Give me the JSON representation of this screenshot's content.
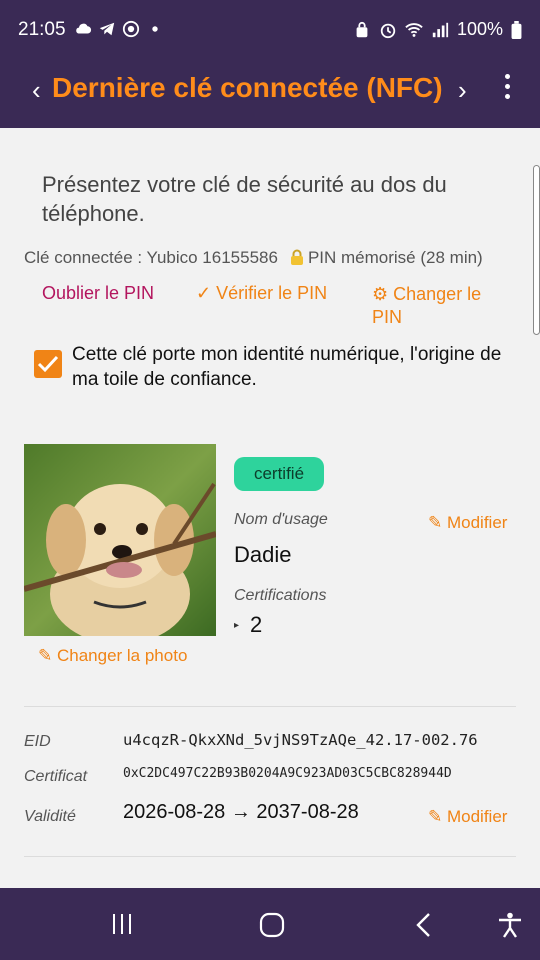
{
  "status": {
    "time": "21:05",
    "battery": "100%"
  },
  "appbar": {
    "prev": "‹",
    "title": "Dernière clé connectée (NFC)",
    "next": "›"
  },
  "prompt": "Présentez votre clé de sécurité au dos du téléphone.",
  "key_info": {
    "connected": "Clé connectée : Yubico 16155586",
    "pin_status": "PIN mémorisé (28 min)"
  },
  "pin_actions": {
    "forget": "Oublier le PIN",
    "verify": "✓ Vérifier le PIN",
    "change": "⚙ Changer le PIN"
  },
  "identity_checkbox": {
    "checked": true,
    "label": "Cette clé porte mon identité numérique, l'origine de ma toile de confiance."
  },
  "profile": {
    "badge": "certifié",
    "change_photo": "✎  Changer la photo",
    "usage_label": "Nom d'usage",
    "usage_edit": "✎ Modifier",
    "usage_value": "Dadie",
    "cert_label": "Certifications",
    "cert_arrow": "▸",
    "cert_count": "2"
  },
  "details": {
    "eid_label": "EID",
    "eid_value": "u4cqzR-QkxXNd_5vjNS9TzAQe_42.17-002.76",
    "cert_label": "Certificat",
    "cert_value": "0xC2DC497C22B93B0204A9C923AD03C5CBC828944D",
    "validity_label": "Validité",
    "validity_value": "2026-08-28 → 2037-08-28",
    "validity_edit": "✎ Modifier"
  },
  "colors": {
    "bar": "#3a2a55",
    "accent": "#f08416",
    "forget": "#b3155e",
    "badge": "#2ed39c"
  }
}
